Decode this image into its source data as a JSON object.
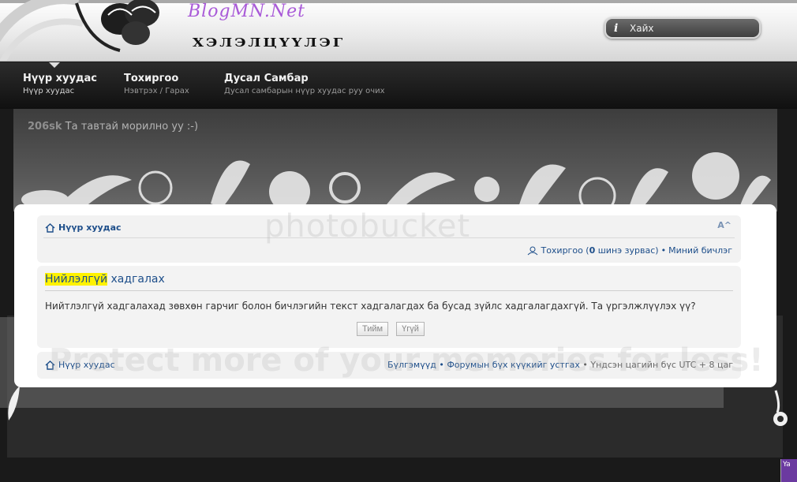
{
  "header": {
    "brand": "BlogMN.Net",
    "site_title": "ХЭЛЭЛЦҮҮЛЭГ",
    "search_label": "Хайх"
  },
  "nav": {
    "items": [
      {
        "title": "Нүүр хуудас",
        "subtitle": "Нүүр хуудас"
      },
      {
        "title": "Тохиргоо",
        "subtitle": "Нэвтрэх / Гарах"
      },
      {
        "title": "Дусал Самбар",
        "subtitle": "Дусал самбарын нүүр хуудас руу очих"
      }
    ]
  },
  "banner": {
    "username": "206sk",
    "welcome_text": "Та тавтай морилно уу :-)"
  },
  "breadcrumb": {
    "home_label": "Нүүр хуудас",
    "font_size_ctrl": "A^"
  },
  "user_links": {
    "settings_label": "Тохиргоо (",
    "new_count": "0",
    "new_messages_suffix": " шинэ зурвас)",
    "separator": " • ",
    "my_posts": "Миний бичлэг"
  },
  "content": {
    "title_highlight": "Нийлэлгүй",
    "title_rest": " хадгалах",
    "message": "Нийтлэлгүй хадгалахад зөвхөн гарчиг болон бичлэгийн текст хадгалагдах ба бусад зүйлс хадгалагдахгүй. Та үргэлжлүүлэх үү?",
    "yes_button": "Тийм",
    "no_button": "Үгүй"
  },
  "footer": {
    "home_label": "Нүүр хуудас",
    "groups": "Бүлгэмүүд",
    "sep": " • ",
    "delete_cookies": "Форумын бүх күүкийг устгах",
    "timezone": "Үндсэн цагийн бүс UTC + 8 цаг"
  },
  "watermark": {
    "line1": "photobucket",
    "line2": "Protect more of your memories for less!"
  },
  "badge": {
    "text": "Ya"
  },
  "colors": {
    "link": "#1d4e8a",
    "highlight": "#fff200",
    "brand": "#a95ad8"
  }
}
